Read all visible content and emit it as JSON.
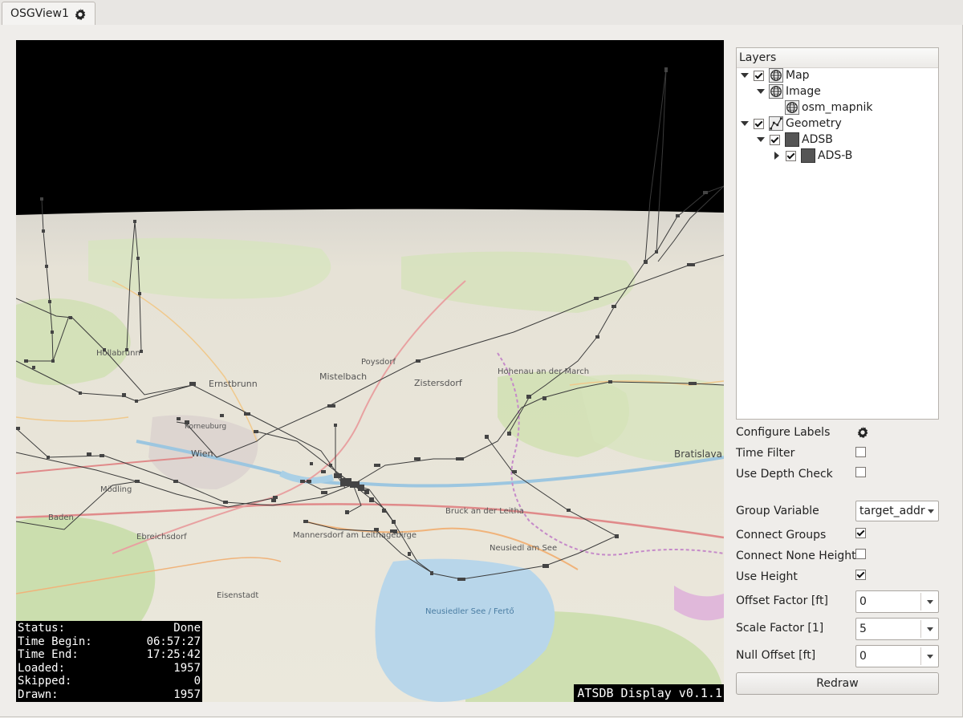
{
  "tab": {
    "label": "OSGView1",
    "icon": "gear-icon"
  },
  "layers": {
    "header": "Layers",
    "items": [
      {
        "label": "Map",
        "icon": "globe-icon",
        "checked": true,
        "expanded": true
      },
      {
        "label": "Image",
        "icon": "globe-icon",
        "expanded": true
      },
      {
        "label": "osm_mapnik",
        "icon": "globe-icon"
      },
      {
        "label": "Geometry",
        "icon": "geometry-icon",
        "checked": true,
        "expanded": true
      },
      {
        "label": "ADSB",
        "icon": "gray-square-icon",
        "checked": true,
        "expanded": true
      },
      {
        "label": "ADS-B",
        "icon": "gray-square-icon",
        "checked": true,
        "expanded": false
      }
    ]
  },
  "controls": {
    "configure_labels": "Configure Labels",
    "time_filter": {
      "label": "Time Filter",
      "checked": false
    },
    "use_depth_check": {
      "label": "Use Depth Check",
      "checked": false
    },
    "group_variable": {
      "label": "Group Variable",
      "value": "target_addr"
    },
    "connect_groups": {
      "label": "Connect Groups",
      "checked": true
    },
    "connect_none_height": {
      "label": "Connect None Height",
      "checked": false
    },
    "use_height": {
      "label": "Use Height",
      "checked": true
    },
    "offset_factor": {
      "label": "Offset Factor [ft]",
      "value": "0"
    },
    "scale_factor": {
      "label": "Scale Factor [1]",
      "value": "5"
    },
    "null_offset": {
      "label": "Null Offset [ft]",
      "value": "0"
    },
    "redraw": "Redraw"
  },
  "status": {
    "rows": [
      {
        "label": "Status:",
        "value": "Done"
      },
      {
        "label": "Time Begin:",
        "value": "06:57:27"
      },
      {
        "label": "Time End:",
        "value": "17:25:42"
      },
      {
        "label": "Loaded:",
        "value": "1957"
      },
      {
        "label": "Skipped:",
        "value": "0"
      },
      {
        "label": "Drawn:",
        "value": "1957"
      }
    ]
  },
  "version": "ATSDB Display v0.1.1",
  "map": {
    "place_labels": [
      "Wien",
      "Ernstbrunn",
      "Mistelbach",
      "Zistersdorf",
      "Bruck an der Leitha",
      "Neusiedl am See",
      "Eisenstadt",
      "Bratislava",
      "Neusiedler See / Fertő",
      "Mannersdorf am Leithagebirge",
      "Ebreichsdorf",
      "Baden",
      "Mödling",
      "Hollabrunn",
      "Korneuburg",
      "Poysdorf",
      "Hohenau an der March"
    ],
    "colors": {
      "sky": "#000000",
      "land": "#e9e6d6",
      "forest": "#c8dfaa",
      "water": "#b4d3e6",
      "tracks": "#3a3a3a"
    }
  }
}
